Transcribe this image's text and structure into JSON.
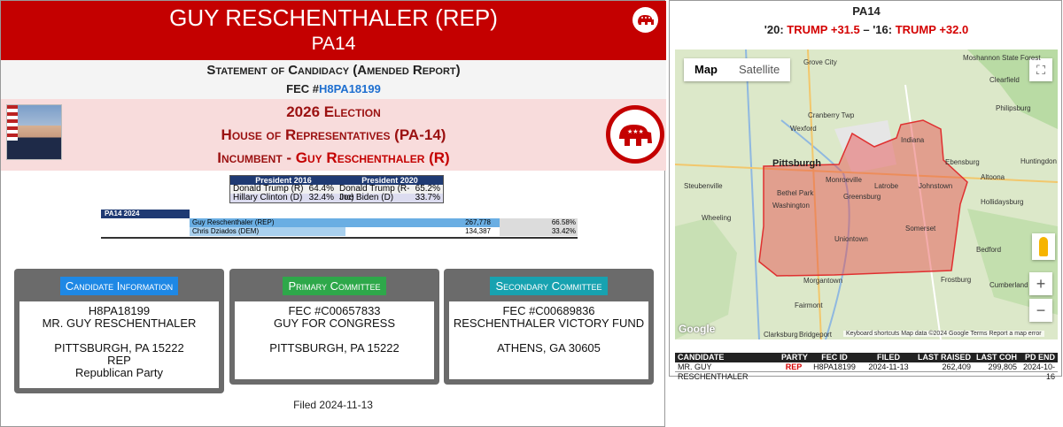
{
  "header": {
    "candidate_title": "GUY RESCHENTHALER (REP)",
    "district": "PA14",
    "logo_icon": "republican-elephant-icon"
  },
  "statement": {
    "title": "Statement of Candidacy (Amended Report)",
    "fec_prefix": "FEC #",
    "fec_id": "H8PA18199"
  },
  "election": {
    "year_label": "2026 Election",
    "office": "House of Representatives (PA-14)",
    "incumbent_prefix": "Incumbent - ",
    "incumbent_name": "Guy Reschenthaler (R)"
  },
  "president": {
    "headers": [
      "President 2016",
      "President 2020"
    ],
    "row1": {
      "c1_name": "Donald Trump (R)",
      "c1_pct": "64.4%",
      "c2_name": "Donald Trump (R-Inc)",
      "c2_pct": "65.2%"
    },
    "row2": {
      "c1_name": "Hillary Clinton (D)",
      "c1_pct": "32.4%",
      "c2_name": "Joe Biden (D)",
      "c2_pct": "33.7%"
    }
  },
  "results": {
    "header": "PA14 2024",
    "rows": [
      {
        "name": "Guy Reschenthaler (REP)",
        "votes": "267,778",
        "pct": "66.58%",
        "share": 0.6658
      },
      {
        "name": "Chris Dziados (DEM)",
        "votes": "134,387",
        "pct": "33.42%",
        "share": 0.3342
      }
    ]
  },
  "boxes": {
    "candidate": {
      "label": "Candidate Information",
      "label_color": "#1e88e5",
      "l1": "H8PA18199",
      "l2": "MR. GUY RESCHENTHALER",
      "l3": "PITTSBURGH, PA 15222",
      "l4": "REP",
      "l5": "Republican Party"
    },
    "primary": {
      "label": "Primary Committee",
      "label_color": "#2ea84a",
      "l1": "FEC #C00657833",
      "l2": "GUY FOR CONGRESS",
      "l3": "PITTSBURGH, PA 15222"
    },
    "secondary": {
      "label": "Secondary Committee",
      "label_color": "#17a2b0",
      "l1": "FEC #C00689836",
      "l2": "RESCHENTHALER VICTORY FUND",
      "l3": "ATHENS, GA 30605"
    }
  },
  "filed": "Filed 2024-11-13",
  "right": {
    "title": "PA14",
    "line_prefix_20": "'20: ",
    "margin_20": "TRUMP +31.5",
    "sep": " – '16: ",
    "margin_16": "TRUMP +32.0",
    "map": {
      "btn_map": "Map",
      "btn_satellite": "Satellite",
      "google": "Google",
      "attribution": "Keyboard shortcuts   Map data ©2024 Google   Terms   Report a map error",
      "zoom_in": "+",
      "zoom_out": "−",
      "fullscreen_icon": "fullscreen-icon",
      "cities": {
        "pittsburgh": "Pittsburgh",
        "grove_city": "Grove City",
        "moshannon": "Moshannon State Forest",
        "clearfield": "Clearfield",
        "philipsburg": "Philipsburg",
        "indiana": "Indiana",
        "wexford": "Wexford",
        "cranberry": "Cranberry Twp",
        "ebensburg": "Ebensburg",
        "altoona": "Altoona",
        "huntingdon": "Huntingdon",
        "monroeville": "Monroeville",
        "latrobe": "Latrobe",
        "johnstown": "Johnstown",
        "hollidaysburg": "Hollidaysburg",
        "steubenville": "Steubenville",
        "bethel_park": "Bethel Park",
        "greensburg": "Greensburg",
        "washington": "Washington",
        "wheeling": "Wheeling",
        "somerset": "Somerset",
        "bedford": "Bedford",
        "uniontown": "Uniontown",
        "morgantown": "Morgantown",
        "frostburg": "Frostburg",
        "cumberland": "Cumberland",
        "fairmont": "Fairmont",
        "clarksburg": "Clarksburg",
        "bridgeport": "Bridgeport"
      }
    },
    "table": {
      "headers": [
        "CANDIDATE",
        "PARTY",
        "FEC ID",
        "FILED",
        "LAST RAISED",
        "LAST COH",
        "PD END"
      ],
      "row": [
        "MR. GUY RESCHENTHALER",
        "REP",
        "H8PA18199",
        "2024-11-13",
        "262,409",
        "299,805",
        "2024-10-16"
      ]
    }
  }
}
